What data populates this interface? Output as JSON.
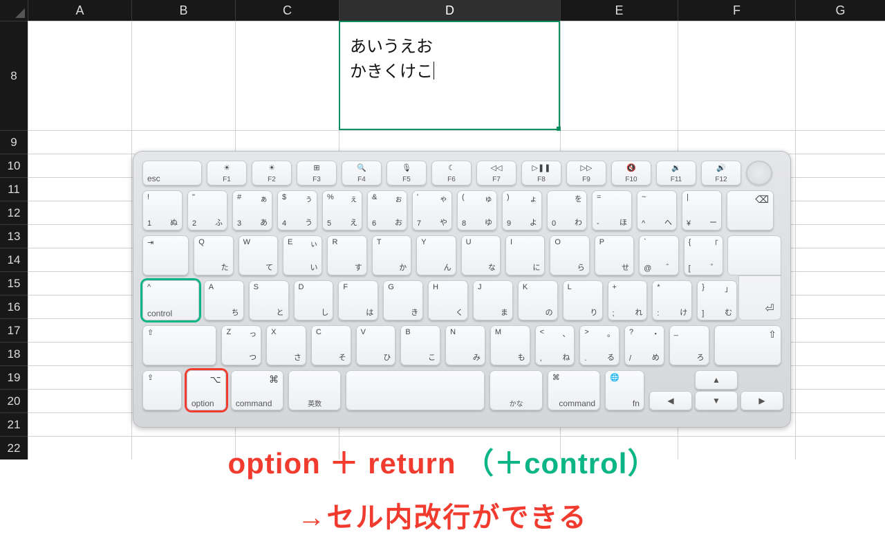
{
  "columns": [
    "A",
    "B",
    "C",
    "D",
    "E",
    "F",
    "G"
  ],
  "selected_column": "D",
  "first_row_number": 8,
  "rows": [
    8,
    9,
    10,
    11,
    12,
    13,
    14,
    15,
    16,
    17,
    18,
    19,
    20,
    21,
    22
  ],
  "cell": {
    "line1": "あいうえお",
    "line2": "かきくけこ"
  },
  "keyboard": {
    "fn": [
      "esc",
      "F1",
      "F2",
      "F3",
      "F4",
      "F5",
      "F6",
      "F7",
      "F8",
      "F9",
      "F10",
      "F11",
      "F12"
    ],
    "fn_icons": [
      "",
      "☀",
      "☀",
      "⊞",
      "🔍",
      "🎙",
      "☾",
      "◁◁",
      "▷❚❚",
      "▷▷",
      "🔇",
      "🔉",
      "🔊"
    ],
    "num_row": [
      {
        "tl": "!",
        "bl": "1",
        "br": "ぬ"
      },
      {
        "tl": "\"",
        "bl": "2",
        "br": "ふ"
      },
      {
        "tl": "#",
        "bl": "3",
        "tr": "ぁ",
        "br": "あ"
      },
      {
        "tl": "$",
        "bl": "4",
        "tr": "ぅ",
        "br": "う"
      },
      {
        "tl": "%",
        "bl": "5",
        "tr": "ぇ",
        "br": "え"
      },
      {
        "tl": "&",
        "bl": "6",
        "tr": "ぉ",
        "br": "お"
      },
      {
        "tl": "'",
        "bl": "7",
        "tr": "ゃ",
        "br": "や"
      },
      {
        "tl": "(",
        "bl": "8",
        "tr": "ゅ",
        "br": "ゆ"
      },
      {
        "tl": ")",
        "bl": "9",
        "tr": "ょ",
        "br": "よ"
      },
      {
        "tl": "",
        "bl": "0",
        "tr": "を",
        "br": "わ"
      },
      {
        "tl": "=",
        "bl": "-",
        "br": "ほ"
      },
      {
        "tl": "~",
        "bl": "^",
        "br": "へ"
      },
      {
        "tl": "|",
        "bl": "¥",
        "br": "ー"
      }
    ],
    "q_row": [
      {
        "tl": "Q",
        "br": "た"
      },
      {
        "tl": "W",
        "br": "て"
      },
      {
        "tl": "E",
        "tr": "ぃ",
        "br": "い"
      },
      {
        "tl": "R",
        "br": "す"
      },
      {
        "tl": "T",
        "br": "か"
      },
      {
        "tl": "Y",
        "br": "ん"
      },
      {
        "tl": "U",
        "br": "な"
      },
      {
        "tl": "I",
        "br": "に"
      },
      {
        "tl": "O",
        "br": "ら"
      },
      {
        "tl": "P",
        "br": "せ"
      },
      {
        "tl": "`",
        "bl": "@",
        "br": "゛"
      },
      {
        "tl": "{",
        "bl": "[",
        "tr": "「",
        "br": "゜"
      }
    ],
    "a_row": [
      {
        "tl": "A",
        "br": "ち"
      },
      {
        "tl": "S",
        "br": "と"
      },
      {
        "tl": "D",
        "br": "し"
      },
      {
        "tl": "F",
        "br": "は"
      },
      {
        "tl": "G",
        "br": "き"
      },
      {
        "tl": "H",
        "br": "く"
      },
      {
        "tl": "J",
        "br": "ま"
      },
      {
        "tl": "K",
        "br": "の"
      },
      {
        "tl": "L",
        "br": "り"
      },
      {
        "tl": "+",
        "bl": ";",
        "br": "れ"
      },
      {
        "tl": "*",
        "bl": ":",
        "br": "け"
      },
      {
        "tl": "}",
        "bl": "]",
        "tr": "」",
        "br": "む"
      }
    ],
    "z_row": [
      {
        "tl": "Z",
        "tr": "っ",
        "br": "つ"
      },
      {
        "tl": "X",
        "br": "さ"
      },
      {
        "tl": "C",
        "br": "そ"
      },
      {
        "tl": "V",
        "br": "ひ"
      },
      {
        "tl": "B",
        "br": "こ"
      },
      {
        "tl": "N",
        "br": "み"
      },
      {
        "tl": "M",
        "br": "も"
      },
      {
        "tl": "<",
        "bl": ",",
        "tr": "、",
        "br": "ね"
      },
      {
        "tl": ">",
        "bl": ".",
        "tr": "。",
        "br": "る"
      },
      {
        "tl": "?",
        "bl": "/",
        "tr": "・",
        "br": "め"
      },
      {
        "tl": "_",
        "br": "ろ"
      }
    ],
    "control": "control",
    "option": "option",
    "command": "command",
    "eisu": "英数",
    "kana": "かな",
    "fn_label": "fn",
    "caps": "⇪",
    "shift": "⇧",
    "delete": "⌫",
    "tab": "⇥",
    "return": "⏎",
    "globe": "🌐"
  },
  "caption": {
    "part1": "option ＋ return",
    "part2": "（＋control）",
    "line2": "→セル内改行ができる"
  }
}
